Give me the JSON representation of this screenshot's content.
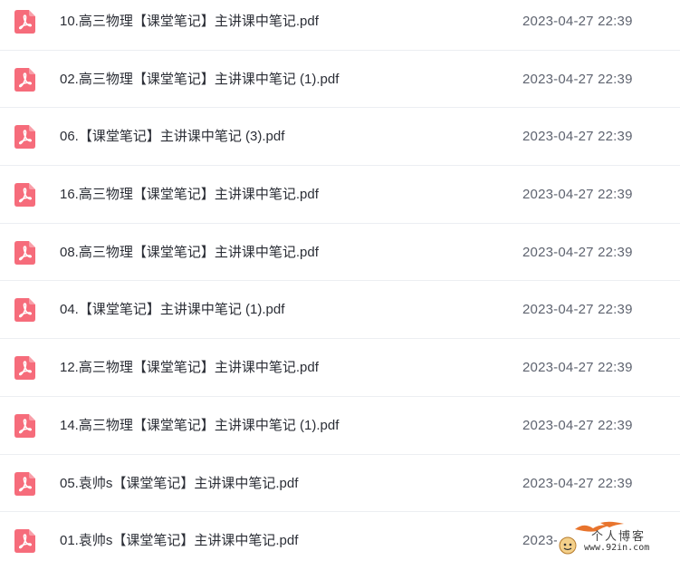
{
  "files": [
    {
      "name": "10.高三物理【课堂笔记】主讲课中笔记.pdf",
      "date": "2023-04-27 22:39"
    },
    {
      "name": "02.高三物理【课堂笔记】主讲课中笔记 (1).pdf",
      "date": "2023-04-27 22:39"
    },
    {
      "name": "06.【课堂笔记】主讲课中笔记 (3).pdf",
      "date": "2023-04-27 22:39"
    },
    {
      "name": "16.高三物理【课堂笔记】主讲课中笔记.pdf",
      "date": "2023-04-27 22:39"
    },
    {
      "name": "08.高三物理【课堂笔记】主讲课中笔记.pdf",
      "date": "2023-04-27 22:39"
    },
    {
      "name": "04.【课堂笔记】主讲课中笔记 (1).pdf",
      "date": "2023-04-27 22:39"
    },
    {
      "name": "12.高三物理【课堂笔记】主讲课中笔记.pdf",
      "date": "2023-04-27 22:39"
    },
    {
      "name": "14.高三物理【课堂笔记】主讲课中笔记 (1).pdf",
      "date": "2023-04-27 22:39"
    },
    {
      "name": "05.袁帅s【课堂笔记】主讲课中笔记.pdf",
      "date": "2023-04-27 22:39"
    },
    {
      "name": "01.袁帅s【课堂笔记】主讲课中笔记.pdf",
      "date": "2023-"
    }
  ],
  "icon": "pdf-file-icon",
  "colors": {
    "pdf_icon": "#f66c7b",
    "name_text": "#2b2e36",
    "date_text": "#5f6470",
    "divider": "#eceef2"
  },
  "watermark": {
    "title": "个人博客",
    "url": "www.92in.com"
  }
}
